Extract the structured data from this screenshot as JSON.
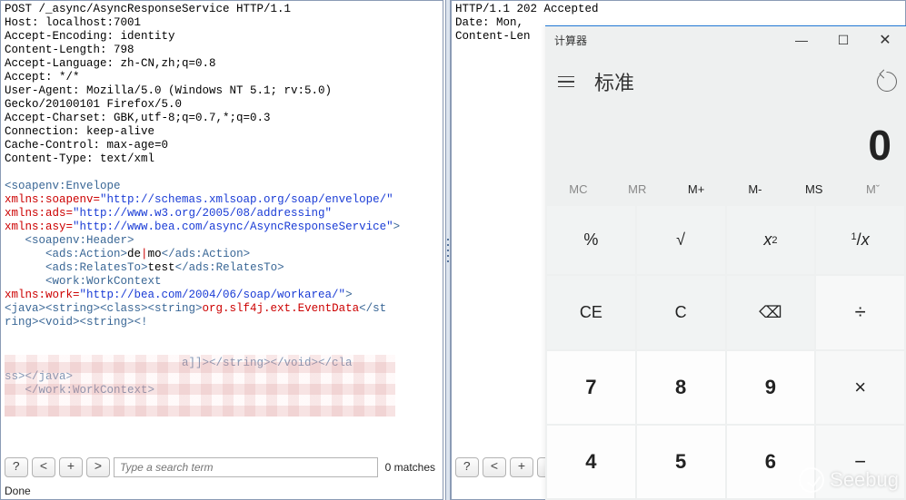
{
  "left_panel": {
    "lines": [
      "POST /_async/AsyncResponseService HTTP/1.1",
      "Host: localhost:7001",
      "Accept-Encoding: identity",
      "Content-Length: 798",
      "Accept-Language: zh-CN,zh;q=0.8",
      "Accept: */*",
      "User-Agent: Mozilla/5.0 (Windows NT 5.1; rv:5.0)",
      "Gecko/20100101 Firefox/5.0",
      "Accept-Charset: GBK,utf-8;q=0.7,*;q=0.3",
      "Connection: keep-alive",
      "Cache-Control: max-age=0",
      "Content-Type: text/xml",
      ""
    ],
    "xml_lines": [
      {
        "pre": "",
        "tag": "<soapenv:Envelope"
      },
      {
        "pre": "",
        "attr": "xmlns:soapenv=",
        "str": "\"http://schemas.xmlsoap.org/soap/envelope/\""
      },
      {
        "pre": "",
        "attr": "xmlns:ads=",
        "str": "\"http://www.w3.org/2005/08/addressing\""
      },
      {
        "pre": "",
        "attr": "xmlns:asy=",
        "str": "\"http://www.bea.com/async/AsyncResponseService\"",
        "tail": ">"
      },
      {
        "pre": "   ",
        "tag": "<soapenv:Header>"
      },
      {
        "pre": "      ",
        "tag": "<ads:Action>",
        "text_l": "de",
        "cursor": "|",
        "text_r": "mo",
        "close": "</ads:Action>"
      },
      {
        "pre": "      ",
        "tag": "<ads:RelatesTo>",
        "text": "test",
        "close": "</ads:RelatesTo>"
      },
      {
        "pre": "      ",
        "tag": "<work:WorkContext"
      },
      {
        "pre": "",
        "attr": "xmlns:work=",
        "str": "\"http://bea.com/2004/06/soap/workarea/\"",
        "tail": ">"
      },
      {
        "pre": "",
        "tags": "<java><string><class><string>",
        "red": "org.slf4j.ext.EventData",
        "tail2": "</st"
      },
      {
        "pre": "",
        "textonly": "ring><void><string><!"
      },
      {
        "pre": "",
        "blank": true
      },
      {
        "pre": "",
        "blank": true
      },
      {
        "pre": "",
        "textonly2": "                          a]]></string></void></cla"
      },
      {
        "pre": "",
        "textonly": "ss></java>"
      },
      {
        "pre": "   ",
        "tag": "</work:WorkContext>"
      }
    ],
    "search": {
      "help": "?",
      "prev": "<",
      "add": "+",
      "next": ">",
      "placeholder": "Type a search term",
      "matches": "0 matches"
    },
    "status": "Done"
  },
  "right_panel": {
    "lines": [
      "HTTP/1.1 202 Accepted",
      "Date: Mon, ",
      "Content-Len"
    ],
    "search": {
      "help": "?",
      "prev": "<",
      "add": "+",
      "next": ">"
    }
  },
  "calculator": {
    "title": "计算器",
    "mode": "标准",
    "display": "0",
    "memory": [
      "MC",
      "MR",
      "M+",
      "M-",
      "MS",
      "Mˇ"
    ],
    "memory_active": [
      false,
      false,
      true,
      true,
      true,
      false
    ],
    "keys": [
      [
        "%",
        "√",
        "x²",
        "¹/ₓ"
      ],
      [
        "CE",
        "C",
        "⌫",
        "÷"
      ],
      [
        "7",
        "8",
        "9",
        "×"
      ],
      [
        "4",
        "5",
        "6",
        "−"
      ]
    ],
    "key_class": [
      [
        "func",
        "func",
        "func",
        "func"
      ],
      [
        "func",
        "func",
        "func",
        "op"
      ],
      [
        "num",
        "num",
        "num",
        "op"
      ],
      [
        "num",
        "num",
        "num",
        "op"
      ]
    ],
    "win_buttons": {
      "min": "—",
      "max": "☐",
      "close": "✕"
    }
  },
  "watermark": "Seebug"
}
